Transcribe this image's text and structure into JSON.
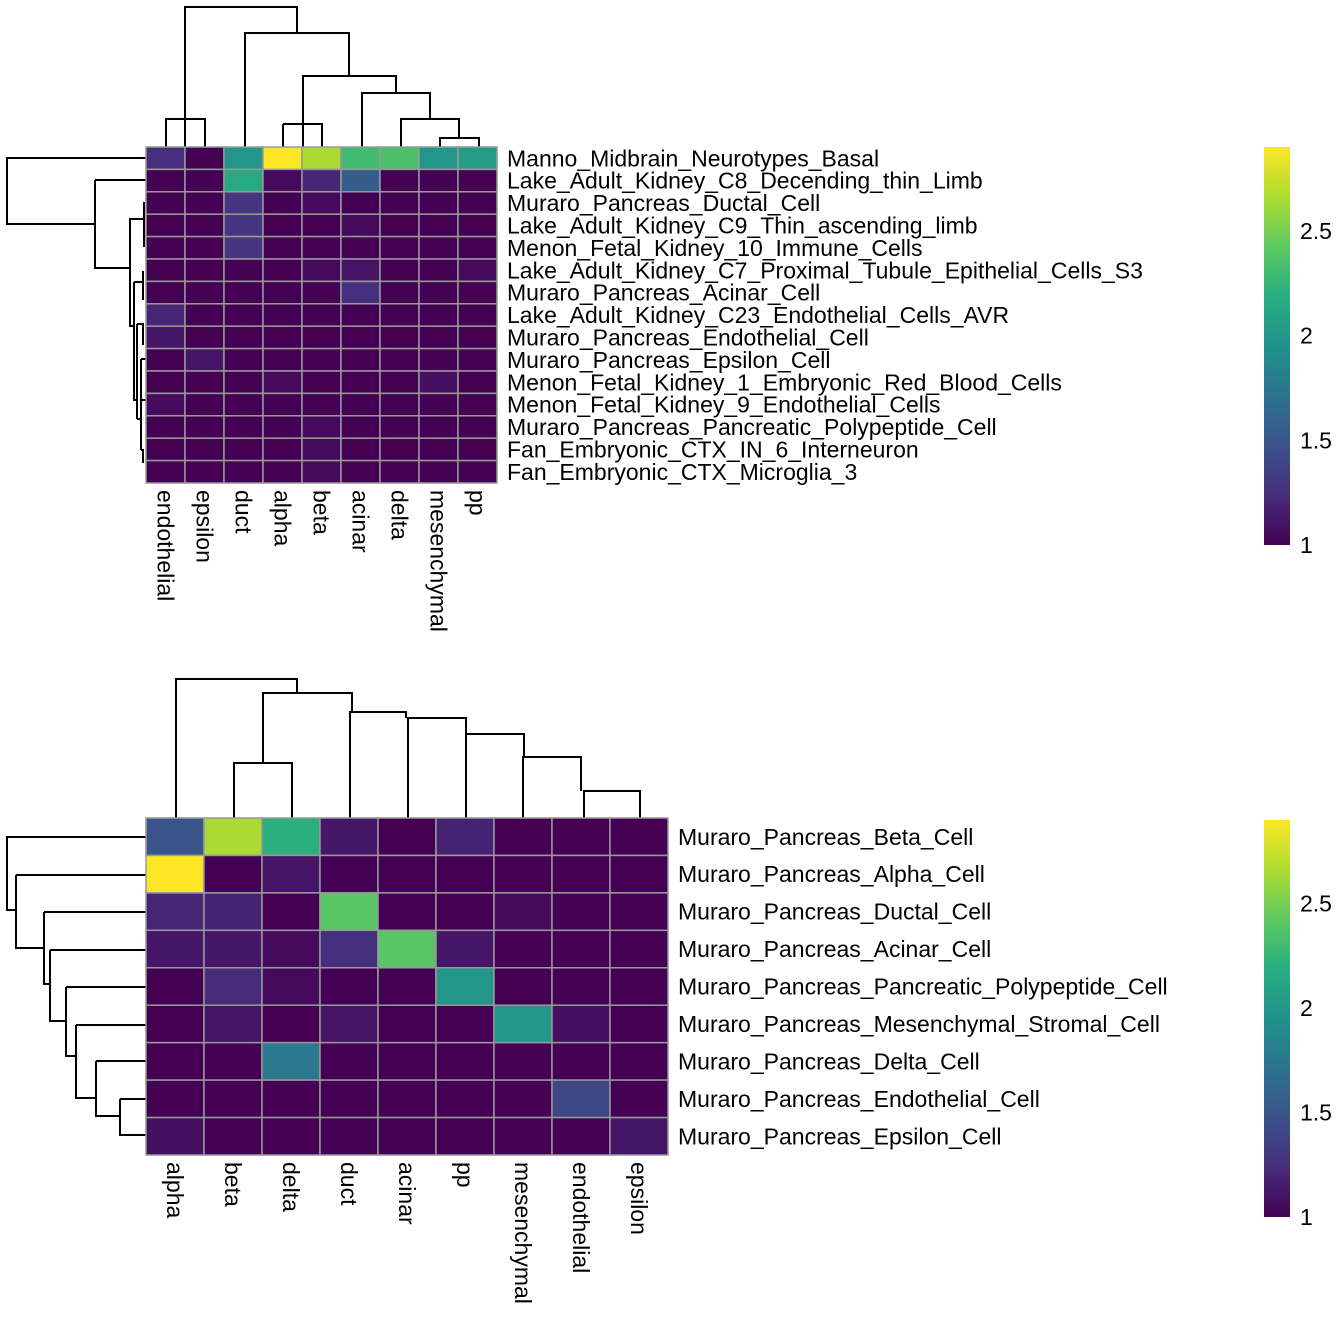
{
  "chart_data": [
    {
      "type": "heatmap",
      "title": "",
      "columns": [
        "endothelial",
        "epsilon",
        "duct",
        "alpha",
        "beta",
        "acinar",
        "delta",
        "mesenchymal",
        "pp"
      ],
      "rows": [
        "Manno_Midbrain_Neurotypes_Basal",
        "Lake_Adult_Kidney_C8_Decending_thin_Limb",
        "Muraro_Pancreas_Ductal_Cell",
        "Lake_Adult_Kidney_C9_Thin_ascending_limb",
        "Menon_Fetal_Kidney_10_Immune_Cells",
        "Lake_Adult_Kidney_C7_Proximal_Tubule_Epithelial_Cells_S3",
        "Muraro_Pancreas_Acinar_Cell",
        "Lake_Adult_Kidney_C23_Endothelial_Cells_AVR",
        "Muraro_Pancreas_Endothelial_Cell",
        "Muraro_Pancreas_Epsilon_Cell",
        "Menon_Fetal_Kidney_1_Embryonic_Red_Blood_Cells",
        "Menon_Fetal_Kidney_9_Endothelial_Cells",
        "Muraro_Pancreas_Pancreatic_Polypeptide_Cell",
        "Fan_Embryonic_CTX_IN_6_Interneuron",
        "Fan_Embryonic_CTX_Microglia_3"
      ],
      "values": [
        [
          1.25,
          1.0,
          2.0,
          2.9,
          2.65,
          2.3,
          2.35,
          2.0,
          2.05
        ],
        [
          1.0,
          1.0,
          2.15,
          1.05,
          1.2,
          1.55,
          1.0,
          1.0,
          1.0
        ],
        [
          1.0,
          1.0,
          1.3,
          1.0,
          1.05,
          1.0,
          1.0,
          1.0,
          1.0
        ],
        [
          1.0,
          1.0,
          1.3,
          1.0,
          1.0,
          1.05,
          1.0,
          1.0,
          1.0
        ],
        [
          1.0,
          1.0,
          1.3,
          1.0,
          1.0,
          1.0,
          1.0,
          1.0,
          1.0
        ],
        [
          1.0,
          1.0,
          1.0,
          1.0,
          1.05,
          1.1,
          1.0,
          1.0,
          1.05
        ],
        [
          1.0,
          1.0,
          1.0,
          1.0,
          1.0,
          1.25,
          1.0,
          1.0,
          1.0
        ],
        [
          1.2,
          1.0,
          1.0,
          1.0,
          1.0,
          1.0,
          1.0,
          1.0,
          1.0
        ],
        [
          1.12,
          1.0,
          1.0,
          1.0,
          1.0,
          1.0,
          1.0,
          1.0,
          1.0
        ],
        [
          1.0,
          1.1,
          1.0,
          1.0,
          1.0,
          1.0,
          1.0,
          1.0,
          1.0
        ],
        [
          1.0,
          1.0,
          1.0,
          1.05,
          1.0,
          1.0,
          1.0,
          1.08,
          1.0
        ],
        [
          1.05,
          1.0,
          1.0,
          1.0,
          1.0,
          1.0,
          1.0,
          1.0,
          1.0
        ],
        [
          1.0,
          1.0,
          1.0,
          1.0,
          1.05,
          1.0,
          1.0,
          1.0,
          1.0
        ],
        [
          1.0,
          1.0,
          1.0,
          1.0,
          1.05,
          1.0,
          1.0,
          1.0,
          1.0
        ],
        [
          1.0,
          1.0,
          1.0,
          1.0,
          1.05,
          1.0,
          1.0,
          1.0,
          1.0
        ]
      ],
      "colorscale": "viridis",
      "colorbar": {
        "range": [
          1,
          2.9
        ],
        "ticks": [
          1,
          1.5,
          2,
          2.5
        ],
        "tick_labels": [
          "1",
          "1.5",
          "2",
          "2.5"
        ]
      },
      "row_dendrogram": true,
      "col_dendrogram": true,
      "grid": true
    },
    {
      "type": "heatmap",
      "title": "",
      "columns": [
        "alpha",
        "beta",
        "delta",
        "duct",
        "acinar",
        "pp",
        "mesenchymal",
        "endothelial",
        "epsilon"
      ],
      "rows": [
        "Muraro_Pancreas_Beta_Cell",
        "Muraro_Pancreas_Alpha_Cell",
        "Muraro_Pancreas_Ductal_Cell",
        "Muraro_Pancreas_Acinar_Cell",
        "Muraro_Pancreas_Pancreatic_Polypeptide_Cell",
        "Muraro_Pancreas_Mesenchymal_Stromal_Cell",
        "Muraro_Pancreas_Delta_Cell",
        "Muraro_Pancreas_Endothelial_Cell",
        "Muraro_Pancreas_Epsilon_Cell"
      ],
      "values": [
        [
          1.5,
          2.65,
          2.2,
          1.12,
          1.0,
          1.18,
          1.0,
          1.0,
          1.0
        ],
        [
          2.9,
          1.0,
          1.1,
          1.0,
          1.0,
          1.0,
          1.0,
          1.0,
          1.0
        ],
        [
          1.2,
          1.18,
          1.0,
          2.4,
          1.0,
          1.0,
          1.05,
          1.0,
          1.0
        ],
        [
          1.12,
          1.12,
          1.05,
          1.25,
          2.4,
          1.12,
          1.0,
          1.0,
          1.0
        ],
        [
          1.0,
          1.22,
          1.05,
          1.0,
          1.0,
          2.0,
          1.0,
          1.0,
          1.0
        ],
        [
          1.0,
          1.1,
          1.0,
          1.1,
          1.0,
          1.0,
          2.0,
          1.08,
          1.0
        ],
        [
          1.0,
          1.0,
          1.75,
          1.0,
          1.0,
          1.0,
          1.0,
          1.0,
          1.0
        ],
        [
          1.0,
          1.0,
          1.0,
          1.0,
          1.0,
          1.0,
          1.0,
          1.4,
          1.0
        ],
        [
          1.08,
          1.0,
          1.0,
          1.0,
          1.0,
          1.0,
          1.0,
          1.0,
          1.12
        ]
      ],
      "colorscale": "viridis",
      "colorbar": {
        "range": [
          1,
          2.9
        ],
        "ticks": [
          1,
          1.5,
          2,
          2.5
        ],
        "tick_labels": [
          "1",
          "1.5",
          "2",
          "2.5"
        ]
      },
      "row_dendrogram": true,
      "col_dendrogram": true,
      "grid": true
    }
  ]
}
